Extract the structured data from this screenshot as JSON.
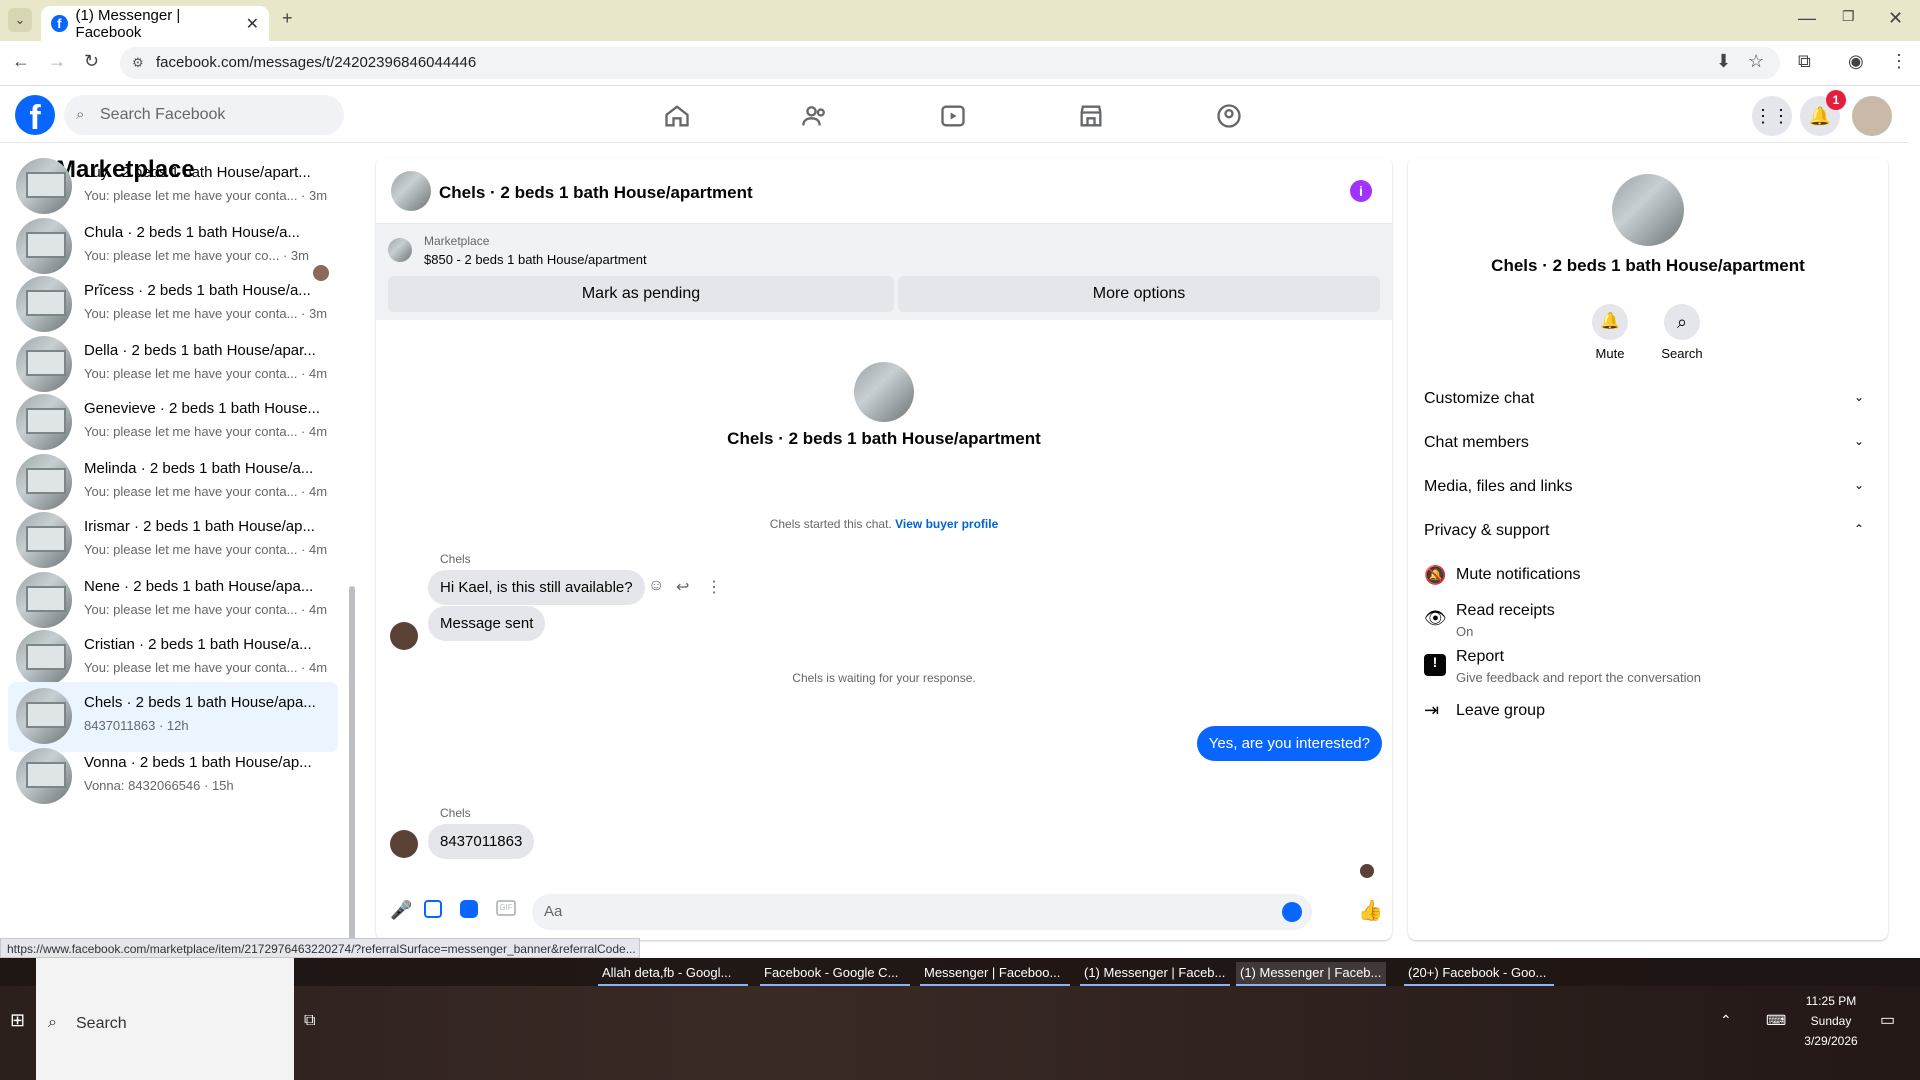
{
  "browser": {
    "tab_title": "(1) Messenger | Facebook",
    "url": "facebook.com/messages/t/24202396846044446"
  },
  "fb_header": {
    "search_placeholder": "Search Facebook",
    "notification_count": "1"
  },
  "sidebar": {
    "title": "Marketplace",
    "conversations": [
      {
        "title": "Luy · 2 beds 1 bath House/apart...",
        "preview": "You: please let me have your conta... · 3m"
      },
      {
        "title": "Chula · 2 beds 1 bath House/a...",
        "preview": "You: please let me have your co... · 3m"
      },
      {
        "title": "Prĩcess · 2 beds 1 bath House/a...",
        "preview": "You: please let me have your conta... · 3m"
      },
      {
        "title": "Della · 2 beds 1 bath House/apar...",
        "preview": "You: please let me have your conta... · 4m"
      },
      {
        "title": "Genevieve · 2 beds 1 bath House...",
        "preview": "You: please let me have your conta... · 4m"
      },
      {
        "title": "Melinda · 2 beds 1 bath House/a...",
        "preview": "You: please let me have your conta... · 4m"
      },
      {
        "title": "Irismar · 2 beds 1 bath House/ap...",
        "preview": "You: please let me have your conta... · 4m"
      },
      {
        "title": "Nene · 2 beds 1 bath House/apa...",
        "preview": "You: please let me have your conta... · 4m"
      },
      {
        "title": "Cristian · 2 beds 1 bath House/a...",
        "preview": "You: please let me have your conta... · 4m"
      },
      {
        "title": "Chels · 2 beds 1 bath House/apa...",
        "preview": "8437011863 · 12h"
      },
      {
        "title": "Vonna · 2 beds 1 bath House/ap...",
        "preview": "Vonna: 8432066546 · 15h"
      }
    ]
  },
  "chat": {
    "header_title": "Chels · 2 beds 1 bath House/apartment",
    "listing_label": "Marketplace",
    "listing_detail": "$850 - 2 beds 1 bath House/apartment",
    "mark_pending": "Mark as pending",
    "more_options": "More options",
    "intro_name": "Chels · 2 beds 1 bath House/apartment",
    "started_text": "Chels started this chat.",
    "view_buyer": "View buyer profile",
    "sender1": "Chels",
    "msg1": "Hi Kael, is this still available?",
    "msg2": "Message sent",
    "waiting": "Chels is waiting for your response.",
    "msg3": "Yes, are you interested?",
    "sender2": "Chels",
    "msg4": "8437011863",
    "composer_placeholder": "Aa"
  },
  "info_panel": {
    "title": "Chels · 2 beds 1 bath House/apartment",
    "mute_label": "Mute",
    "search_label": "Search",
    "customize": "Customize chat",
    "members": "Chat members",
    "media": "Media, files and links",
    "privacy": "Privacy & support",
    "mute_notif": "Mute notifications",
    "read_receipts": "Read receipts",
    "read_receipts_status": "On",
    "report": "Report",
    "report_sub": "Give feedback and report the conversation",
    "leave": "Leave group"
  },
  "status_url": "https://www.facebook.com/marketplace/item/2172976463220274/?referralSurface=messenger_banner&referralCode...",
  "taskbar": {
    "search": "Search",
    "items": [
      "Allah deta,fb - Googl...",
      "Facebook - Google C...",
      "Messenger | Faceboo...",
      "(1) Messenger | Faceb...",
      "(1) Messenger | Faceb...",
      "(20+) Facebook - Goo..."
    ],
    "time": "11:25 PM",
    "day": "Sunday",
    "date": "3/29/2026"
  },
  "colors": {
    "brand": "#0866ff",
    "badge": "#e41e3f",
    "info": "#a033ff"
  }
}
